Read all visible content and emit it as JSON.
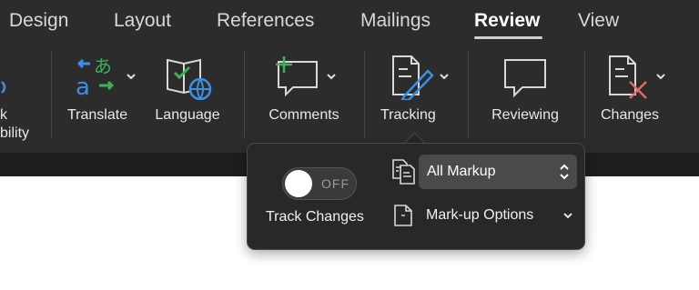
{
  "tabs": [
    {
      "label": "Design"
    },
    {
      "label": "Layout"
    },
    {
      "label": "References"
    },
    {
      "label": "Mailings"
    },
    {
      "label": "Review",
      "active": true
    },
    {
      "label": "View"
    }
  ],
  "ribbon": {
    "partial_labels": [
      "k",
      "bility"
    ],
    "buttons": {
      "translate": "Translate",
      "language": "Language",
      "comments": "Comments",
      "tracking": "Tracking",
      "reviewing": "Reviewing",
      "changes": "Changes"
    }
  },
  "tracking_popup": {
    "toggle_state": "OFF",
    "track_changes_label": "Track Changes",
    "display_select_value": "All Markup",
    "markup_options_label": "Mark-up Options"
  },
  "colors": {
    "ribbon_bg": "#2c2c2c",
    "accent_blue": "#3b8fe5",
    "accent_green": "#3fae5a",
    "delete_mark": "#e06a6a"
  }
}
